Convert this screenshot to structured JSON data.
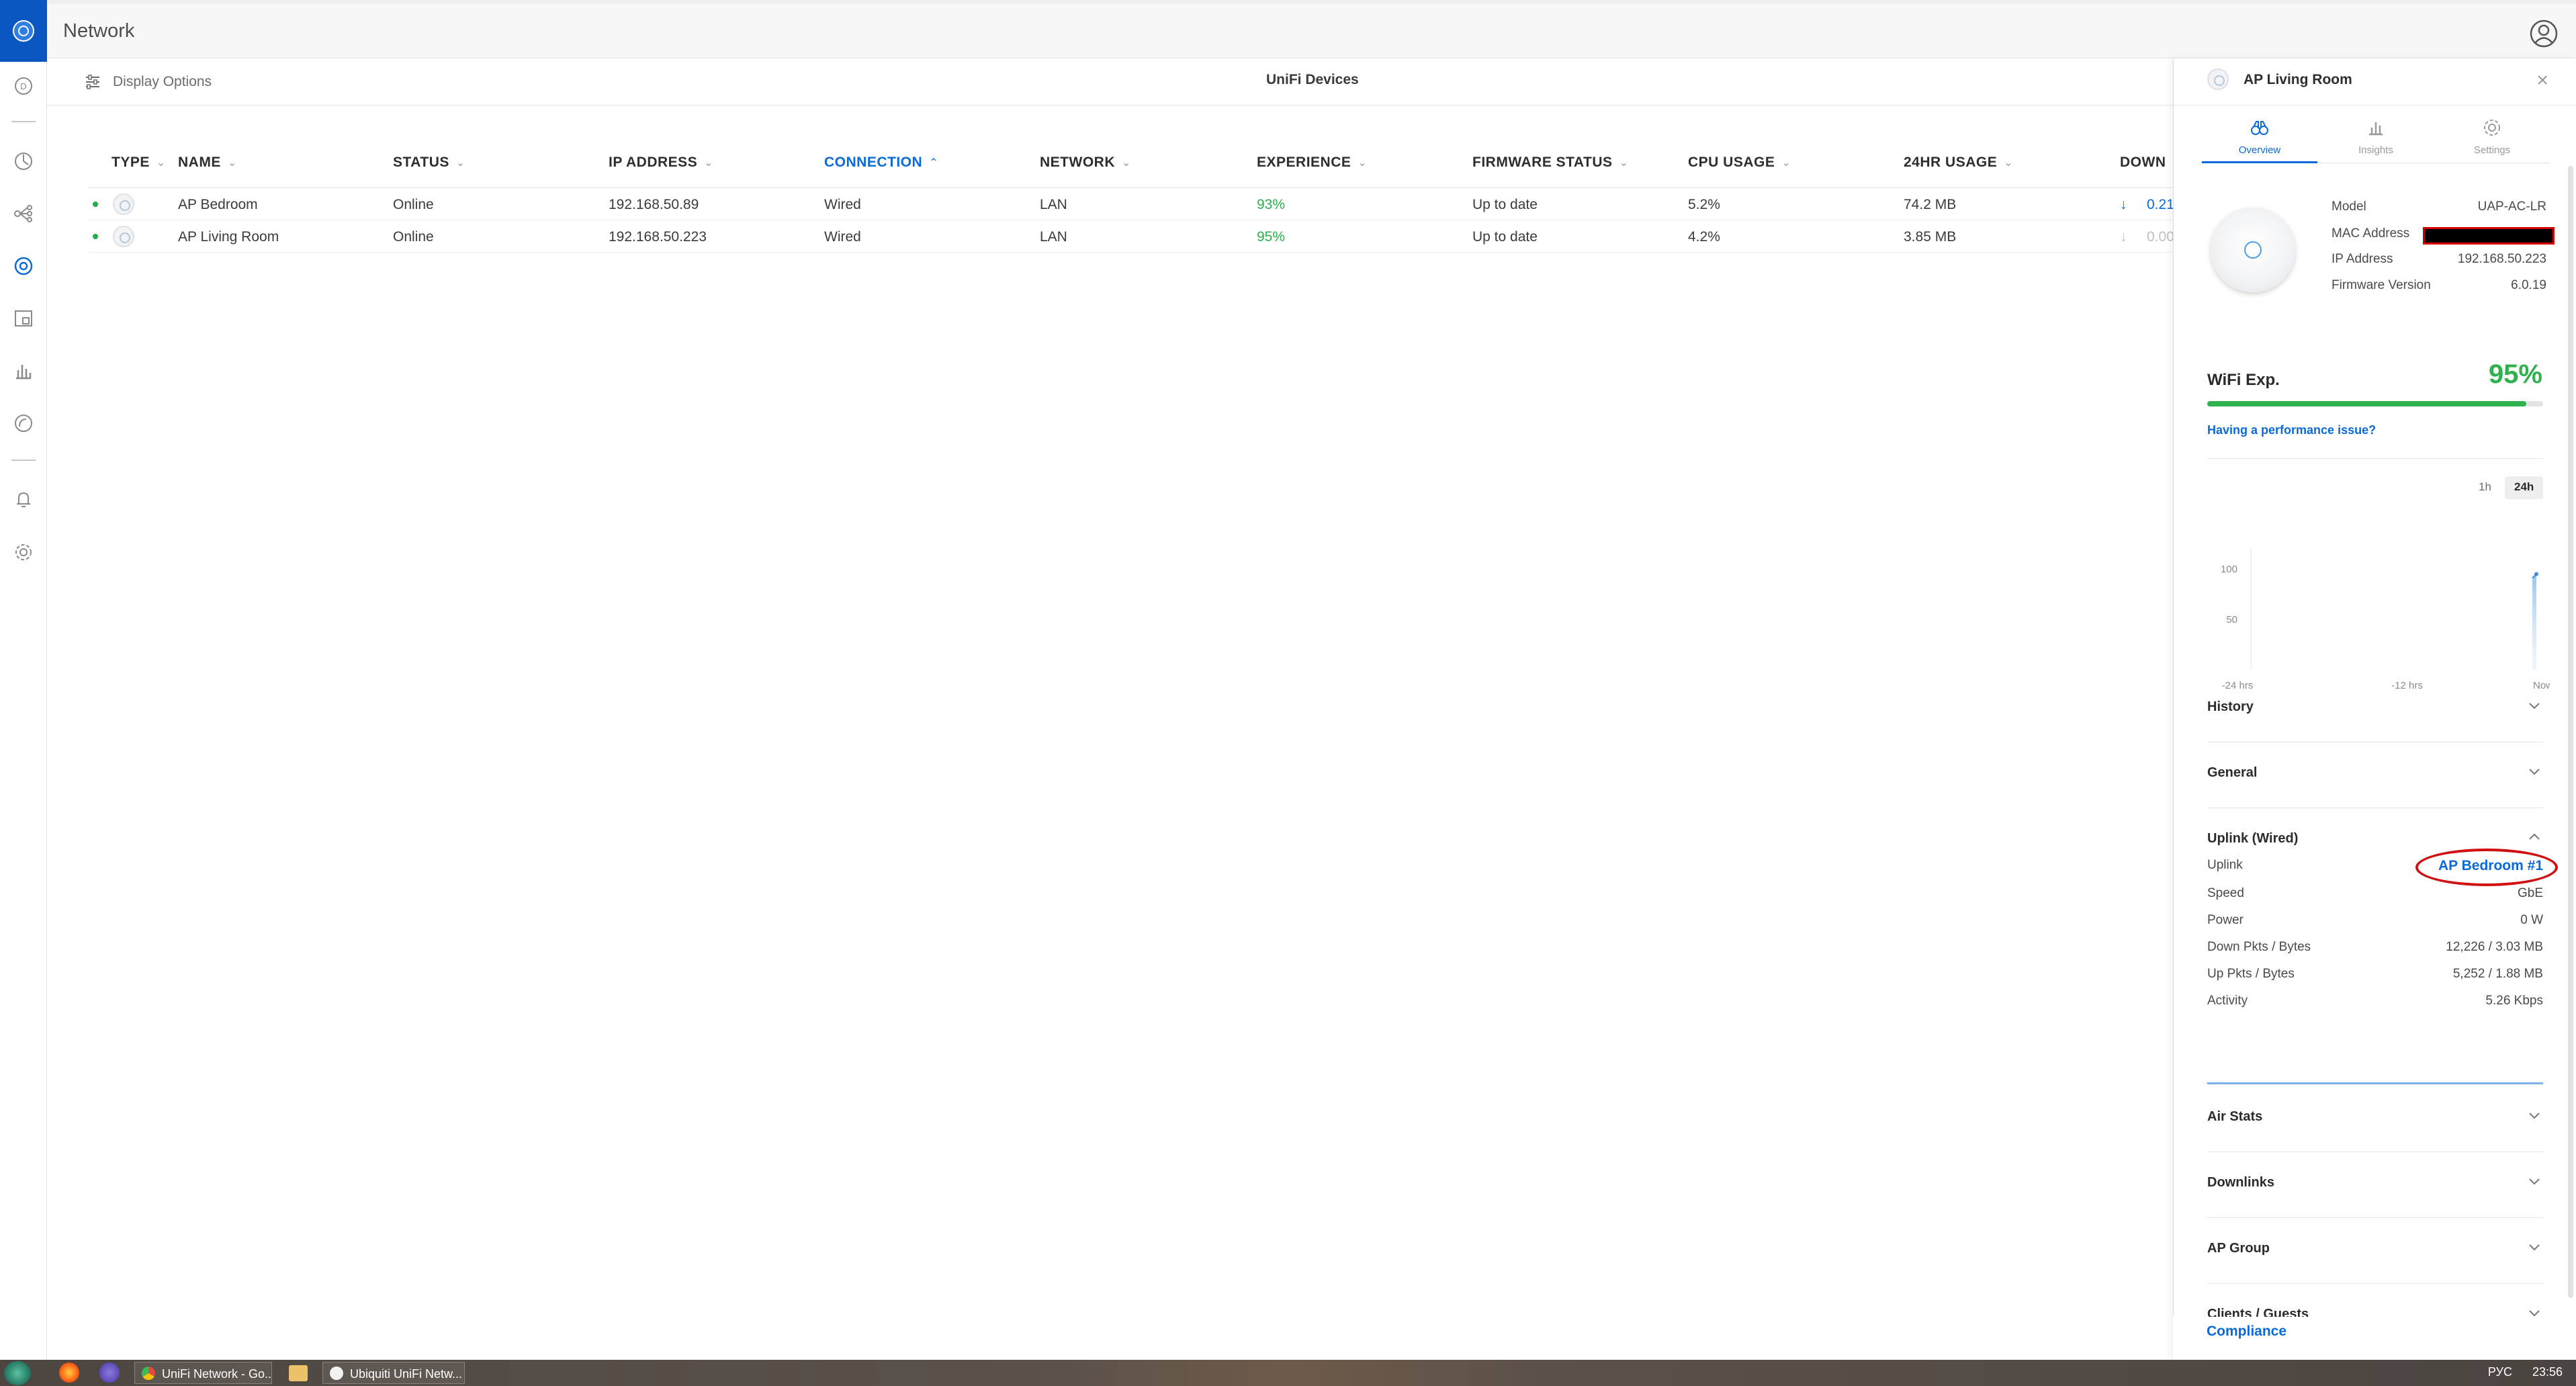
{
  "app": {
    "title": "Network"
  },
  "nav": {
    "items": [
      {
        "name": "dashboard-icon"
      },
      {
        "name": "statistics-icon"
      },
      {
        "name": "topology-icon"
      },
      {
        "name": "devices-icon"
      },
      {
        "name": "clients-icon"
      },
      {
        "name": "insights-icon"
      },
      {
        "name": "events-icon"
      },
      {
        "name": "alerts-icon"
      },
      {
        "name": "settings-icon"
      }
    ]
  },
  "toolbar": {
    "display_options": "Display Options",
    "heading": "UniFi Devices"
  },
  "table": {
    "columns": [
      {
        "label": "TYPE",
        "sort": "none"
      },
      {
        "label": "NAME",
        "sort": "none"
      },
      {
        "label": "STATUS",
        "sort": "none"
      },
      {
        "label": "IP ADDRESS",
        "sort": "none"
      },
      {
        "label": "CONNECTION",
        "sort": "asc"
      },
      {
        "label": "NETWORK",
        "sort": "none"
      },
      {
        "label": "EXPERIENCE",
        "sort": "none"
      },
      {
        "label": "FIRMWARE STATUS",
        "sort": "none"
      },
      {
        "label": "CPU USAGE",
        "sort": "none"
      },
      {
        "label": "24HR USAGE",
        "sort": "none"
      },
      {
        "label": "DOWN",
        "sort": "none"
      }
    ],
    "rows": [
      {
        "name": "AP Bedroom",
        "status": "Online",
        "ip": "192.168.50.89",
        "connection": "Wired",
        "network": "LAN",
        "experience": "93%",
        "firmware": "Up to date",
        "cpu": "5.2%",
        "usage24": "74.2 MB",
        "down": "0.21"
      },
      {
        "name": "AP Living Room",
        "status": "Online",
        "ip": "192.168.50.223",
        "connection": "Wired",
        "network": "LAN",
        "experience": "95%",
        "firmware": "Up to date",
        "cpu": "4.2%",
        "usage24": "3.85 MB",
        "down": "0.00"
      }
    ]
  },
  "panel": {
    "title": "AP Living Room",
    "tabs": [
      {
        "label": "Overview",
        "active": true
      },
      {
        "label": "Insights",
        "active": false
      },
      {
        "label": "Settings",
        "active": false
      }
    ],
    "info": {
      "model_label": "Model",
      "model": "UAP-AC-LR",
      "mac_label": "MAC Address",
      "ip_label": "IP Address",
      "ip": "192.168.50.223",
      "fw_label": "Firmware Version",
      "fw": "6.0.19"
    },
    "wifi": {
      "label": "WiFi Exp.",
      "value": "95%",
      "percent": 95,
      "perf_link": "Having a performance issue?"
    },
    "ranges": {
      "short": "1h",
      "long": "24h",
      "selected": "24h"
    },
    "chart_data": {
      "type": "area",
      "ylim": [
        0,
        100
      ],
      "yticks": [
        "100",
        "50"
      ],
      "xticks": [
        "-24 hrs",
        "-12 hrs",
        "Now"
      ],
      "series": [
        {
          "x": [
            "-24 hrs",
            "Now"
          ],
          "values": [
            0,
            95
          ]
        }
      ]
    },
    "sections": {
      "history": "History",
      "general": "General",
      "uplink": "Uplink (Wired)",
      "air_stats": "Air Stats",
      "downlinks": "Downlinks",
      "ap_group": "AP Group",
      "clients": "Clients / Guests"
    },
    "uplink": {
      "uplink_label": "Uplink",
      "uplink_value": "AP Bedroom #1",
      "speed_label": "Speed",
      "speed": "GbE",
      "power_label": "Power",
      "power": "0 W",
      "down_label": "Down Pkts / Bytes",
      "down": "12,226 / 3.03 MB",
      "up_label": "Up Pkts / Bytes",
      "up": "5,252 / 1.88 MB",
      "activity_label": "Activity",
      "activity": "5.26 Kbps"
    },
    "compliance": "Compliance"
  },
  "taskbar": {
    "tasks": [
      {
        "label": "UniFi Network - Go..."
      },
      {
        "label": "Ubiquiti UniFi Netw..."
      }
    ],
    "lang": "РУС",
    "time": "23:56"
  },
  "colors": {
    "accent": "#0b6ad9",
    "good": "#2fb24d",
    "nav_brand": "#0a57c1",
    "highlight": "#d01010"
  }
}
